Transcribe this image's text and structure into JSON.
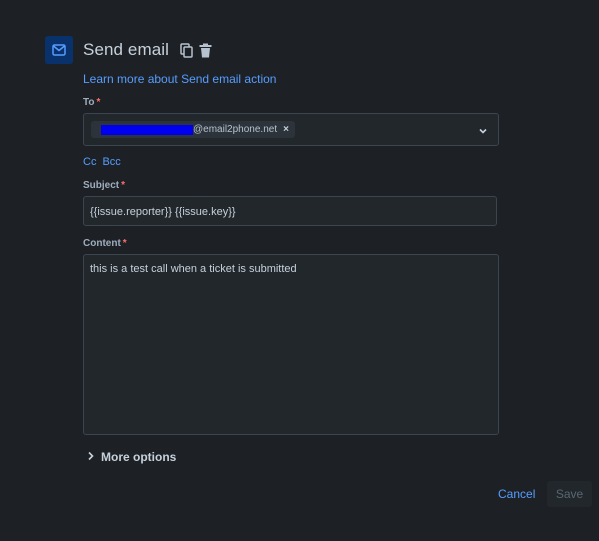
{
  "header": {
    "title": "Send email",
    "icon": "mail-icon",
    "accent": "#579dff"
  },
  "learn_more": "Learn more about Send email action",
  "to": {
    "label": "To",
    "required_mark": "*",
    "recipient_suffix": "@email2phone.net",
    "remove_glyph": "×"
  },
  "cc_label": "Cc",
  "bcc_label": "Bcc",
  "subject": {
    "label": "Subject",
    "required_mark": "*",
    "value": "{{issue.reporter}} {{issue.key}}"
  },
  "content": {
    "label": "Content",
    "required_mark": "*",
    "value": "this is a test call when a ticket is submitted"
  },
  "more_options": "More options",
  "actions": {
    "cancel": "Cancel",
    "save": "Save"
  }
}
